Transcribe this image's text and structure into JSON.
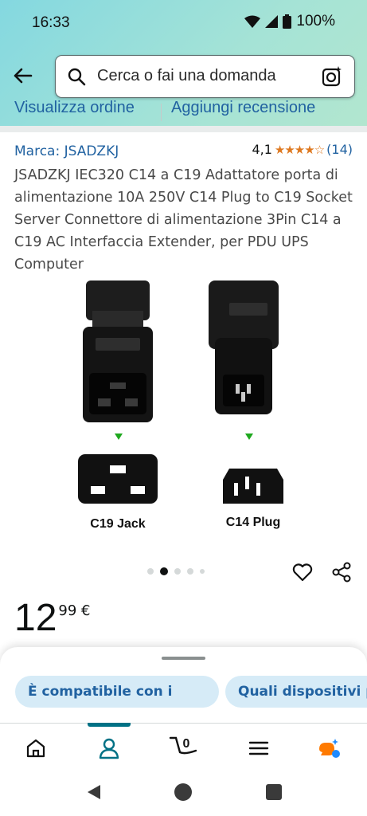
{
  "status_bar": {
    "time": "16:33",
    "battery": "100%"
  },
  "search": {
    "placeholder": "Cerca o fai una domanda"
  },
  "order_links": {
    "view_order": "Visualizza ordine",
    "add_review": "Aggiungi recensione"
  },
  "product": {
    "brand": "Marca: JSADZKJ",
    "rating": "4,1",
    "stars": "★★★★☆",
    "rating_count": "(14)",
    "title": "JSADZKJ IEC320 C14 a C19 Adattatore porta di alimentazione 10A 250V C14 Plug to C19 Socket Server Connettore di alimentazione 3Pin C14 a C19 AC Interfaccia Extender, per PDU UPS Computer",
    "image_labels": {
      "left": "C19 Jack",
      "right": "C14 Plug"
    },
    "carousel": {
      "total": 5,
      "active": 2
    },
    "price_int": "12",
    "price_dec": "99 €"
  },
  "suggestions": [
    "È compatibile con i",
    "Quali dispositivi pu"
  ],
  "bottom_nav": {
    "cart_count": "0"
  },
  "colors": {
    "accent": "#007185",
    "link": "#2162a1",
    "star": "#de7921",
    "chip_bg": "#d6ebf7"
  }
}
